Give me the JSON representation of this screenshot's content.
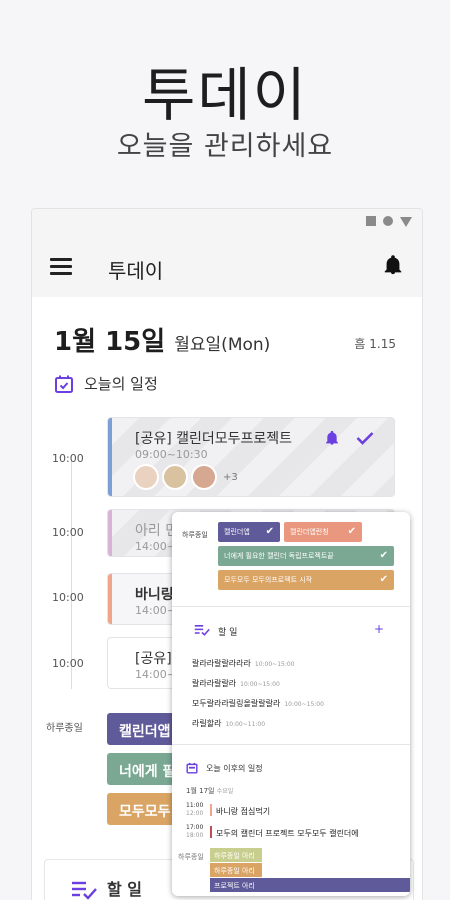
{
  "hero": {
    "title": "투데이",
    "subtitle": "오늘을 관리하세요"
  },
  "app": {
    "title": "투데이",
    "date": "1월 15일",
    "weekday": "월요일(Mon)",
    "weather": "흠 1.15",
    "schedule_section": "오늘의 일정",
    "allday_label": "하루종일",
    "todo_section": "할 일"
  },
  "timeline": [
    {
      "time": "10:00",
      "title": "[공유] 캘린더모두프로젝트",
      "range": "09:00~10:30",
      "more": "+3",
      "color": "#7b9fd6"
    },
    {
      "time": "10:00",
      "title": "아리 먼",
      "range": "14:00~",
      "color": "#d9b3d6"
    },
    {
      "time": "10:00",
      "title": "바니링",
      "range": "14:00~",
      "color": "#f0a58a"
    },
    {
      "time": "10:00",
      "title": "[공유]",
      "range": "14:00~",
      "color": "#ffffff"
    }
  ],
  "allday_chips": [
    {
      "label": "캘린더앱",
      "color": "#5f5a99"
    },
    {
      "label": "너에게 필",
      "color": "#7aa893"
    },
    {
      "label": "모두모두",
      "color": "#d9a464"
    }
  ],
  "overlay": {
    "allday_label": "하루종일",
    "chips": [
      {
        "label": "캘린더앱",
        "color": "#5f5a99"
      },
      {
        "label": "캘린더앱런칭",
        "color": "#e9977e"
      },
      {
        "label": "너에게 필요한 캘린더 독립프로젝트끝",
        "color": "#7aa893"
      },
      {
        "label": "모두모두 모두의프로젝트 시작",
        "color": "#d9a464"
      }
    ],
    "todo_title": "할 일",
    "todo_add": "+",
    "todos": [
      {
        "text": "랄라라랄랄라라라",
        "time": "10:00~15:00"
      },
      {
        "text": "랄라라랄랄라",
        "time": "10:00~15:00"
      },
      {
        "text": "모두랄라라릴링올랄랄랄라",
        "time": "10:00~15:00"
      },
      {
        "text": "라릴할라",
        "time": "10:00~11:00"
      }
    ],
    "upcoming_title": "오늘 이후의 일정",
    "upcoming_date": "1월 17일",
    "upcoming_weekday": "수요일",
    "upcoming": [
      {
        "start": "11:00",
        "end": "12:00",
        "text": "바니랑 점심먹기",
        "color": "#f0a58a"
      },
      {
        "start": "17:00",
        "end": "18:00",
        "text": "모두의 캘린더 프로젝트 모두모두 캘린더에",
        "color": "#c04a55"
      }
    ],
    "upcoming_allday_label": "하루종일",
    "upcoming_bars": [
      {
        "text": "하루종일 아리",
        "color": "#c8cf8e"
      },
      {
        "text": "하루종일 아리",
        "color": "#d9a464"
      },
      {
        "text": "프로젝트 아리",
        "color": "#5f5a99"
      }
    ]
  }
}
